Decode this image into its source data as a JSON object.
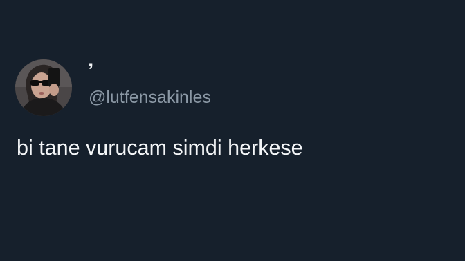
{
  "theme": {
    "background": "#16202c",
    "text_primary": "#f4f6f8",
    "text_secondary": "#8b98a5"
  },
  "tweet": {
    "author": {
      "avatar_icon": "profile-photo-selfie-with-sunglasses",
      "display_name": "’",
      "handle": "@lutfensakinles"
    },
    "text": "bi tane vurucam simdi herkese"
  }
}
